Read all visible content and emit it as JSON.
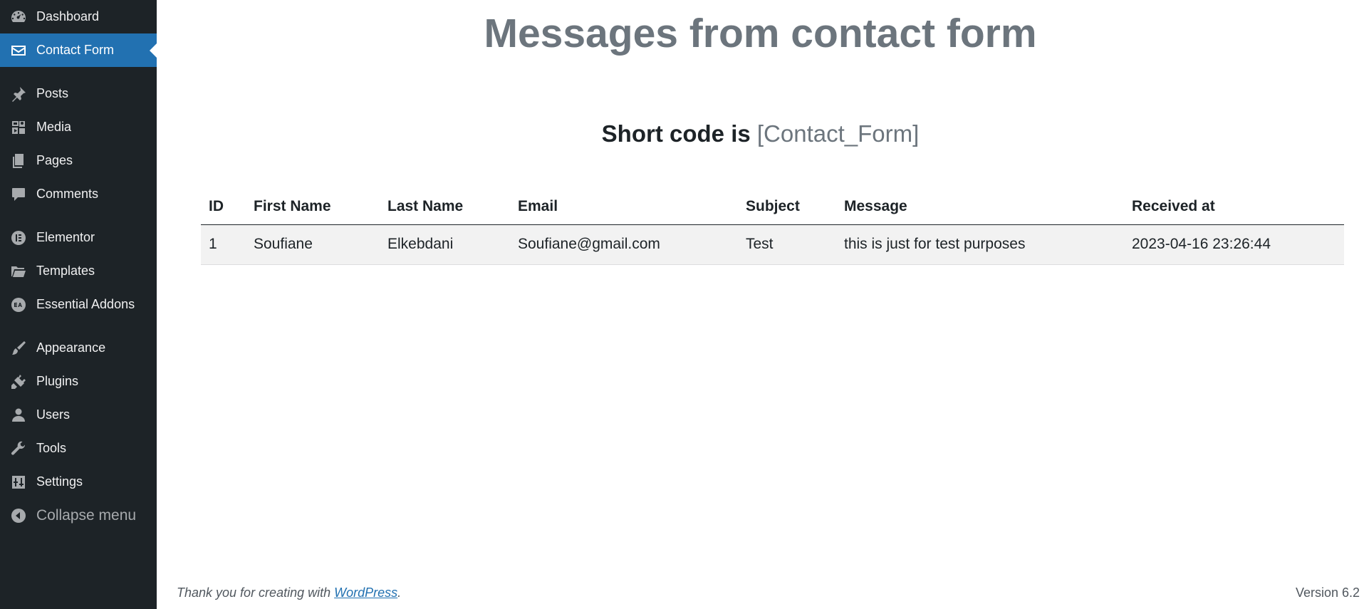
{
  "sidebar": {
    "items": [
      {
        "label": "Dashboard",
        "icon": "dashboard-icon"
      },
      {
        "label": "Contact Form",
        "icon": "envelope-icon",
        "active": true
      },
      {
        "label": "Posts",
        "icon": "pushpin-icon"
      },
      {
        "label": "Media",
        "icon": "media-icon"
      },
      {
        "label": "Pages",
        "icon": "pages-icon"
      },
      {
        "label": "Comments",
        "icon": "comment-icon"
      },
      {
        "label": "Elementor",
        "icon": "elementor-icon"
      },
      {
        "label": "Templates",
        "icon": "folder-icon"
      },
      {
        "label": "Essential Addons",
        "icon": "essential-addons-icon"
      },
      {
        "label": "Appearance",
        "icon": "paintbrush-icon"
      },
      {
        "label": "Plugins",
        "icon": "plug-icon"
      },
      {
        "label": "Users",
        "icon": "user-icon"
      },
      {
        "label": "Tools",
        "icon": "wrench-icon"
      },
      {
        "label": "Settings",
        "icon": "settings-icon"
      }
    ],
    "collapse_label": "Collapse menu"
  },
  "main": {
    "title": "Messages from contact form",
    "shortcode_prefix": "Short code is",
    "shortcode_value": "[Contact_Form]",
    "table": {
      "headers": [
        "ID",
        "First Name",
        "Last Name",
        "Email",
        "Subject",
        "Message",
        "Received at"
      ],
      "rows": [
        [
          "1",
          "Soufiane",
          "Elkebdani",
          "Soufiane@gmail.com",
          "Test",
          "this is just for test purposes",
          "2023-04-16 23:26:44"
        ]
      ]
    }
  },
  "footer": {
    "thanks_prefix": "Thank you for creating with",
    "link_text": "WordPress",
    "thanks_suffix": ".",
    "version": "Version 6.2"
  },
  "colors": {
    "sidebar_bg": "#1d2327",
    "active_bg": "#2271b1",
    "muted_heading": "#6c757d",
    "row_bg": "#f2f2f2"
  }
}
